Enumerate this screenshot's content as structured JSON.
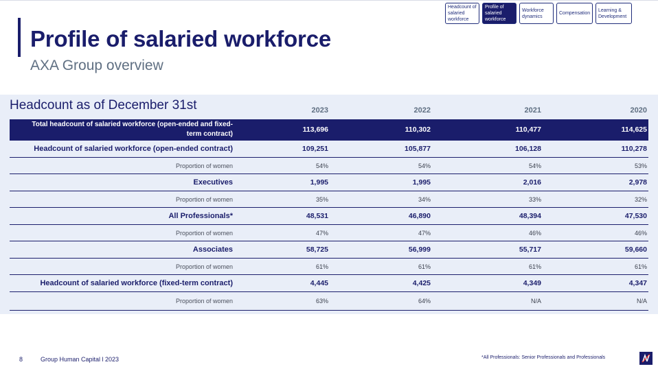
{
  "nav": {
    "tabs": [
      {
        "label": "Headcount of salaried workforce",
        "active": false
      },
      {
        "label": "Profile of salaried workforce",
        "active": true
      },
      {
        "label": "Workforce dynamics",
        "active": false
      },
      {
        "label": "Compensation",
        "active": false
      },
      {
        "label": "Learning & Development",
        "active": false
      }
    ]
  },
  "header": {
    "title": "Profile of salaried workforce",
    "subtitle": "AXA Group overview"
  },
  "table": {
    "heading": "Headcount as of December 31st",
    "years": [
      "2023",
      "2022",
      "2021",
      "2020"
    ],
    "rows": [
      {
        "label": "Total headcount of salaried workforce (open-ended and fixed-term contract)",
        "values": [
          "113,696",
          "110,302",
          "110,477",
          "114,625"
        ],
        "style": "total"
      },
      {
        "label": "Headcount of salaried workforce (open-ended contract)",
        "values": [
          "109,251",
          "105,877",
          "106,128",
          "110,278"
        ],
        "style": "bold"
      },
      {
        "label": "Proportion of women",
        "values": [
          "54%",
          "54%",
          "54%",
          "53%"
        ],
        "style": "sub"
      },
      {
        "label": "Executives",
        "values": [
          "1,995",
          "1,995",
          "2,016",
          "2,978"
        ],
        "style": "bold"
      },
      {
        "label": "Proportion of women",
        "values": [
          "35%",
          "34%",
          "33%",
          "32%"
        ],
        "style": "sub"
      },
      {
        "label": "All Professionals*",
        "values": [
          "48,531",
          "46,890",
          "48,394",
          "47,530"
        ],
        "style": "bold"
      },
      {
        "label": "Proportion of women",
        "values": [
          "47%",
          "47%",
          "46%",
          "46%"
        ],
        "style": "sub"
      },
      {
        "label": "Associates",
        "values": [
          "58,725",
          "56,999",
          "55,717",
          "59,660"
        ],
        "style": "bold"
      },
      {
        "label": "Proportion of women",
        "values": [
          "61%",
          "61%",
          "61%",
          "61%"
        ],
        "style": "sub"
      },
      {
        "label": "Headcount of salaried workforce (fixed-term contract)",
        "values": [
          "4,445",
          "4,425",
          "4,349",
          "4,347"
        ],
        "style": "bold"
      },
      {
        "label": "Proportion of women",
        "values": [
          "63%",
          "64%",
          "N/A",
          "N/A"
        ],
        "style": "last"
      }
    ]
  },
  "footer": {
    "page_number": "8",
    "source": "Group Human Capital l 2023",
    "footnote": "*All Professionals: Senior Professionals and Professionals"
  },
  "colors": {
    "brand_navy": "#1a1d6b",
    "panel_background": "#e9eef8",
    "muted_text": "#5f6f82"
  },
  "icons": {
    "logo": "axa-logo"
  }
}
